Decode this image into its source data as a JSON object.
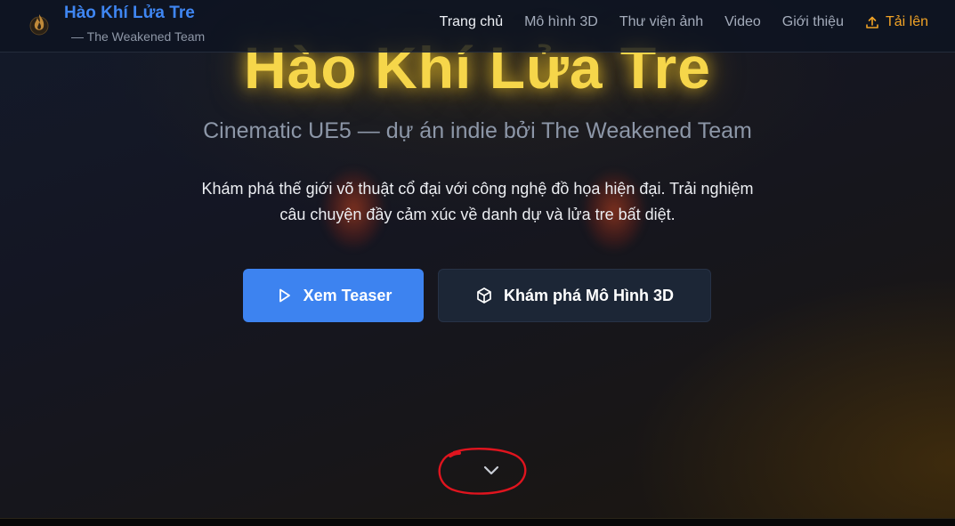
{
  "header": {
    "logo_icon": "flame-icon",
    "title": "Hào Khí Lửa Tre",
    "subtitle": "— The Weakened Team",
    "nav": [
      {
        "label": "Trang chủ",
        "active": true
      },
      {
        "label": "Mô hình 3D",
        "active": false
      },
      {
        "label": "Thư viện ảnh",
        "active": false
      },
      {
        "label": "Video",
        "active": false
      },
      {
        "label": "Giới thiệu",
        "active": false
      }
    ],
    "upload": {
      "label": "Tải lên",
      "icon": "upload-icon",
      "color": "#f1a326"
    }
  },
  "hero": {
    "title": "Hào Khí Lửa Tre",
    "subtitle": "Cinematic UE5 — dự án indie bởi The Weakened Team",
    "description": "Khám phá thế giới võ thuật cổ đại với công nghệ đồ họa hiện đại. Trải nghiệm câu chuyện đầy cảm xúc về danh dự và lửa tre bất diệt.",
    "primary_button": {
      "label": "Xem Teaser",
      "icon": "play-icon",
      "color": "#3d83f0"
    },
    "secondary_button": {
      "label": "Khám phá Mô Hình 3D",
      "icon": "cube-icon"
    },
    "scroll_icon": "chevron-down-icon"
  },
  "colors": {
    "brand_blue": "#3f86f2",
    "title_gold": "#f6d64a",
    "accent_orange": "#f1a326",
    "annotation_red": "#e0141e"
  }
}
